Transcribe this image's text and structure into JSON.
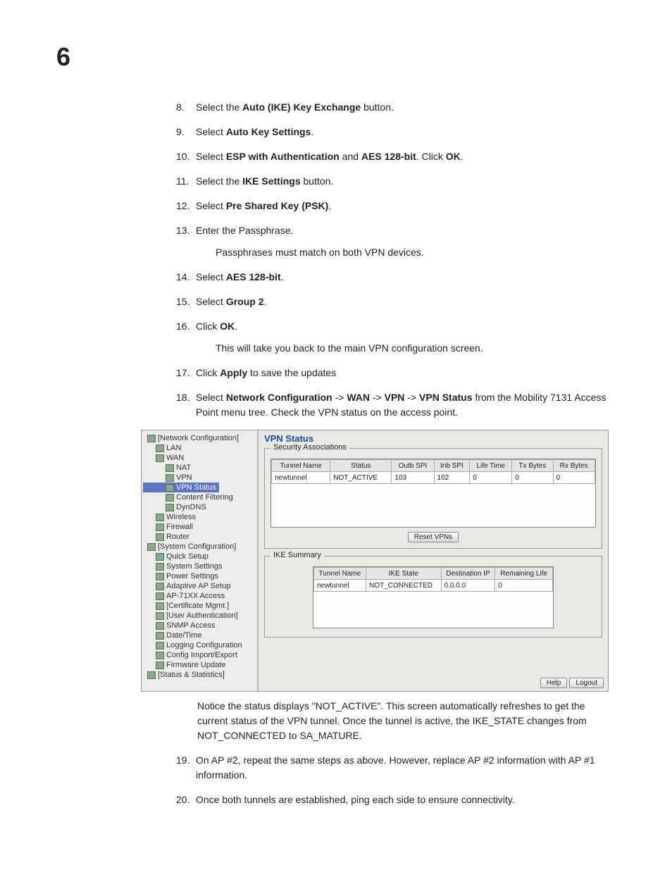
{
  "chapter": "6",
  "steps": [
    {
      "n": "8.",
      "parts": [
        "Select the ",
        {
          "b": "Auto (IKE) Key Exchange"
        },
        " button."
      ]
    },
    {
      "n": "9.",
      "parts": [
        "Select ",
        {
          "b": "Auto Key Settings"
        },
        "."
      ]
    },
    {
      "n": "10.",
      "parts": [
        "Select ",
        {
          "b": "ESP with Authentication"
        },
        " and ",
        {
          "b": "AES 128-bit"
        },
        ". Click ",
        {
          "b": "OK"
        },
        "."
      ]
    },
    {
      "n": "11.",
      "parts": [
        "Select the ",
        {
          "b": "IKE Settings"
        },
        " button."
      ]
    },
    {
      "n": "12.",
      "parts": [
        "Select ",
        {
          "b": "Pre Shared Key (PSK)"
        },
        "."
      ]
    },
    {
      "n": "13.",
      "parts": [
        "Enter the Passphrase."
      ],
      "sub": "Passphrases must match on both VPN devices."
    },
    {
      "n": "14.",
      "parts": [
        "Select ",
        {
          "b": "AES 128-bit"
        },
        "."
      ]
    },
    {
      "n": "15.",
      "parts": [
        "Select ",
        {
          "b": "Group 2"
        },
        "."
      ]
    },
    {
      "n": "16.",
      "parts": [
        "Click ",
        {
          "b": "OK"
        },
        "."
      ],
      "sub": "This will take you back to the main VPN configuration screen."
    },
    {
      "n": "17.",
      "parts": [
        "Click ",
        {
          "b": "Apply"
        },
        " to save the updates"
      ]
    },
    {
      "n": "18.",
      "parts": [
        "Select ",
        {
          "b": "Network Configuration"
        },
        " -> ",
        {
          "b": "WAN"
        },
        " -> ",
        {
          "b": "VPN"
        },
        " -> ",
        {
          "b": "VPN Status"
        },
        " from the Mobility 7131 Access Point menu tree. Check the VPN status on the access point."
      ]
    }
  ],
  "shot": {
    "title": "VPN Status",
    "tree": [
      {
        "lvl": 0,
        "label": "[Network Configuration]"
      },
      {
        "lvl": 1,
        "label": "LAN"
      },
      {
        "lvl": 1,
        "label": "WAN"
      },
      {
        "lvl": 2,
        "label": "NAT"
      },
      {
        "lvl": 2,
        "label": "VPN"
      },
      {
        "lvl": 2,
        "label": "VPN Status",
        "sel": true
      },
      {
        "lvl": 2,
        "label": "Content Filtering"
      },
      {
        "lvl": 2,
        "label": "DynDNS"
      },
      {
        "lvl": 1,
        "label": "Wireless"
      },
      {
        "lvl": 1,
        "label": "Firewall"
      },
      {
        "lvl": 1,
        "label": "Router"
      },
      {
        "lvl": 0,
        "label": "[System Configuration]"
      },
      {
        "lvl": 1,
        "label": "Quick Setup"
      },
      {
        "lvl": 1,
        "label": "System Settings"
      },
      {
        "lvl": 1,
        "label": "Power Settings"
      },
      {
        "lvl": 1,
        "label": "Adaptive AP Setup"
      },
      {
        "lvl": 1,
        "label": "AP-71XX Access"
      },
      {
        "lvl": 1,
        "label": "[Certificate Mgmt.]"
      },
      {
        "lvl": 1,
        "label": "[User Authentication]"
      },
      {
        "lvl": 1,
        "label": "SNMP Access"
      },
      {
        "lvl": 1,
        "label": "Date/Time"
      },
      {
        "lvl": 1,
        "label": "Logging Configuration"
      },
      {
        "lvl": 1,
        "label": "Config Import/Export"
      },
      {
        "lvl": 1,
        "label": "Firmware Update"
      },
      {
        "lvl": 0,
        "label": "[Status & Statistics]"
      }
    ],
    "groups": {
      "sa": {
        "title": "Security Associations",
        "headers": [
          "Tunnel Name",
          "Status",
          "Outb SPI",
          "Inb SPI",
          "Life Time",
          "Tx Bytes",
          "Rx Bytes"
        ],
        "row": [
          "newtunnel",
          "NOT_ACTIVE",
          "103",
          "102",
          "0",
          "0",
          "0"
        ],
        "button": "Reset VPNs"
      },
      "ike": {
        "title": "IKE Summary",
        "headers": [
          "Tunnel Name",
          "IKE State",
          "Destination IP",
          "Remaining Life"
        ],
        "row": [
          "newtunnel",
          "NOT_CONNECTED",
          "0.0.0.0",
          "0"
        ]
      }
    },
    "footer": {
      "help": "Help",
      "logout": "Logout"
    }
  },
  "after_shot_para": "Notice the status displays \"NOT_ACTIVE\".  This screen automatically refreshes to get the current status of the VPN tunnel.  Once the tunnel is active, the IKE_STATE changes from NOT_CONNECTED to SA_MATURE.",
  "steps2": [
    {
      "n": "19.",
      "parts": [
        "On AP #2, repeat the same steps as above. However, replace AP #2 information with AP #1 information."
      ]
    },
    {
      "n": "20.",
      "parts": [
        "Once both tunnels are established, ping each side to ensure connectivity."
      ]
    }
  ]
}
